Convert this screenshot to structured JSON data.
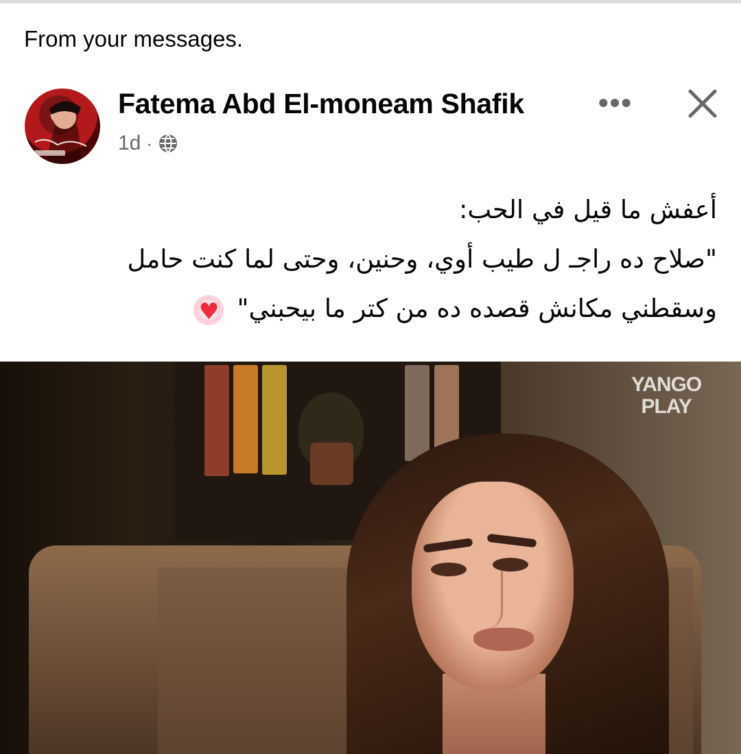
{
  "context": {
    "text": "From your messages."
  },
  "post": {
    "author": "Fatema Abd El-moneam Shafik",
    "time": "1d",
    "separator": "·",
    "more_label": "•••",
    "text_lines": [
      "أعفش ما قيل في الحب:",
      "\"صلاح ده راجـ ل طيب أوي، وحنين، وحتى لما كنت حامل",
      "وسقطني مكانش قصده ده من كتر ما بيحبني\""
    ],
    "emoji": "heart-icon",
    "media": {
      "watermark_line1": "YANGO",
      "watermark_line2": "PLAY"
    }
  },
  "colors": {
    "text": "#050505",
    "secondary": "#65676b",
    "heart": "#f0283a"
  }
}
